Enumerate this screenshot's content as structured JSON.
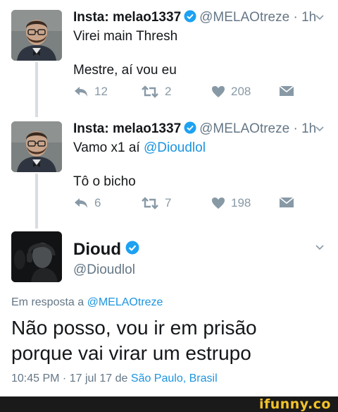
{
  "tweets": [
    {
      "author": "Insta: melao1337",
      "handle": "@MELAOtreze",
      "time": "· 1h",
      "line1": "Virei main Thresh",
      "line2": "Mestre, aí vou eu",
      "reply_count": "12",
      "retweet_count": "2",
      "like_count": "208"
    },
    {
      "author": "Insta: melao1337",
      "handle": "@MELAOtreze",
      "time": "· 1h",
      "line1_prefix": "Vamo x1 aí ",
      "line1_mention": "@Dioudlol",
      "line2": "Tô o bicho",
      "reply_count": "6",
      "retweet_count": "7",
      "like_count": "198"
    }
  ],
  "main_tweet": {
    "author": "Dioud",
    "handle": "@Dioudlol",
    "reply_prefix": "Em resposta a ",
    "reply_mention": "@MELAOtreze",
    "text_line1": "Não posso, vou ir em prisão",
    "text_line2": "porque vai virar um estrupo",
    "timestamp": "10:45 PM · 17 jul 17 de ",
    "place": "São Paulo, Brasil"
  },
  "watermark": "ifunny.co",
  "colors": {
    "link": "#1b95e0",
    "secondary": "#657786",
    "icon": "#8899a6",
    "verified": "#1da1f2",
    "watermark": "#f3c32a"
  },
  "icons": [
    "verified-badge-icon",
    "chevron-down-icon",
    "reply-icon",
    "retweet-icon",
    "like-icon",
    "direct-message-icon"
  ]
}
